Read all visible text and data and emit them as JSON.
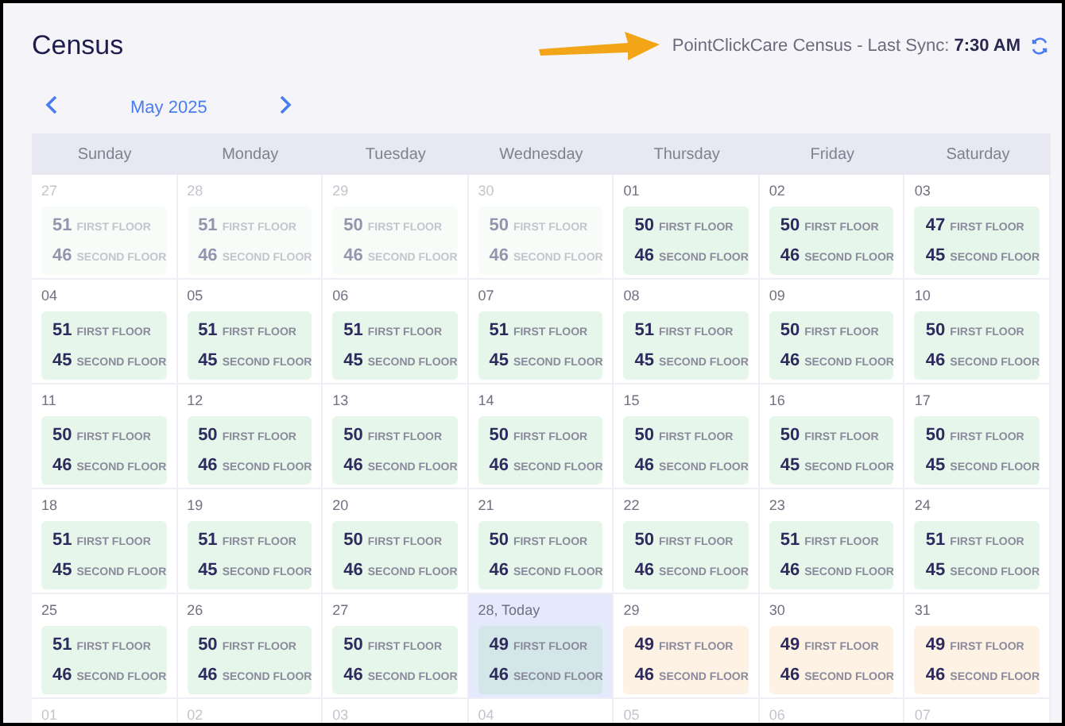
{
  "title": "Census",
  "sync": {
    "label": "PointClickCare Census - Last Sync:",
    "time": "7:30 AM"
  },
  "month": "May 2025",
  "weekdays": [
    "Sunday",
    "Monday",
    "Tuesday",
    "Wednesday",
    "Thursday",
    "Friday",
    "Saturday"
  ],
  "weeks": [
    [
      {
        "date": "27",
        "kind": "outside",
        "floors": [
          {
            "count": "51",
            "label": "FIRST FLOOR"
          },
          {
            "count": "46",
            "label": "SECOND FLOOR"
          }
        ]
      },
      {
        "date": "28",
        "kind": "outside",
        "floors": [
          {
            "count": "51",
            "label": "FIRST FLOOR"
          },
          {
            "count": "46",
            "label": "SECOND FLOOR"
          }
        ]
      },
      {
        "date": "29",
        "kind": "outside",
        "floors": [
          {
            "count": "50",
            "label": "FIRST FLOOR"
          },
          {
            "count": "46",
            "label": "SECOND FLOOR"
          }
        ]
      },
      {
        "date": "30",
        "kind": "outside",
        "floors": [
          {
            "count": "50",
            "label": "FIRST FLOOR"
          },
          {
            "count": "46",
            "label": "SECOND FLOOR"
          }
        ]
      },
      {
        "date": "01",
        "kind": "actual",
        "floors": [
          {
            "count": "50",
            "label": "FIRST FLOOR"
          },
          {
            "count": "46",
            "label": "SECOND FLOOR"
          }
        ]
      },
      {
        "date": "02",
        "kind": "actual",
        "floors": [
          {
            "count": "50",
            "label": "FIRST FLOOR"
          },
          {
            "count": "46",
            "label": "SECOND FLOOR"
          }
        ]
      },
      {
        "date": "03",
        "kind": "actual",
        "floors": [
          {
            "count": "47",
            "label": "FIRST FLOOR"
          },
          {
            "count": "45",
            "label": "SECOND FLOOR"
          }
        ]
      }
    ],
    [
      {
        "date": "04",
        "kind": "actual",
        "floors": [
          {
            "count": "51",
            "label": "FIRST FLOOR"
          },
          {
            "count": "45",
            "label": "SECOND FLOOR"
          }
        ]
      },
      {
        "date": "05",
        "kind": "actual",
        "floors": [
          {
            "count": "51",
            "label": "FIRST FLOOR"
          },
          {
            "count": "45",
            "label": "SECOND FLOOR"
          }
        ]
      },
      {
        "date": "06",
        "kind": "actual",
        "floors": [
          {
            "count": "51",
            "label": "FIRST FLOOR"
          },
          {
            "count": "45",
            "label": "SECOND FLOOR"
          }
        ]
      },
      {
        "date": "07",
        "kind": "actual",
        "floors": [
          {
            "count": "51",
            "label": "FIRST FLOOR"
          },
          {
            "count": "45",
            "label": "SECOND FLOOR"
          }
        ]
      },
      {
        "date": "08",
        "kind": "actual",
        "floors": [
          {
            "count": "51",
            "label": "FIRST FLOOR"
          },
          {
            "count": "45",
            "label": "SECOND FLOOR"
          }
        ]
      },
      {
        "date": "09",
        "kind": "actual",
        "floors": [
          {
            "count": "50",
            "label": "FIRST FLOOR"
          },
          {
            "count": "46",
            "label": "SECOND FLOOR"
          }
        ]
      },
      {
        "date": "10",
        "kind": "actual",
        "floors": [
          {
            "count": "50",
            "label": "FIRST FLOOR"
          },
          {
            "count": "46",
            "label": "SECOND FLOOR"
          }
        ]
      }
    ],
    [
      {
        "date": "11",
        "kind": "actual",
        "floors": [
          {
            "count": "50",
            "label": "FIRST FLOOR"
          },
          {
            "count": "46",
            "label": "SECOND FLOOR"
          }
        ]
      },
      {
        "date": "12",
        "kind": "actual",
        "floors": [
          {
            "count": "50",
            "label": "FIRST FLOOR"
          },
          {
            "count": "46",
            "label": "SECOND FLOOR"
          }
        ]
      },
      {
        "date": "13",
        "kind": "actual",
        "floors": [
          {
            "count": "50",
            "label": "FIRST FLOOR"
          },
          {
            "count": "46",
            "label": "SECOND FLOOR"
          }
        ]
      },
      {
        "date": "14",
        "kind": "actual",
        "floors": [
          {
            "count": "50",
            "label": "FIRST FLOOR"
          },
          {
            "count": "46",
            "label": "SECOND FLOOR"
          }
        ]
      },
      {
        "date": "15",
        "kind": "actual",
        "floors": [
          {
            "count": "50",
            "label": "FIRST FLOOR"
          },
          {
            "count": "46",
            "label": "SECOND FLOOR"
          }
        ]
      },
      {
        "date": "16",
        "kind": "actual",
        "floors": [
          {
            "count": "50",
            "label": "FIRST FLOOR"
          },
          {
            "count": "45",
            "label": "SECOND FLOOR"
          }
        ]
      },
      {
        "date": "17",
        "kind": "actual",
        "floors": [
          {
            "count": "50",
            "label": "FIRST FLOOR"
          },
          {
            "count": "45",
            "label": "SECOND FLOOR"
          }
        ]
      }
    ],
    [
      {
        "date": "18",
        "kind": "actual",
        "floors": [
          {
            "count": "51",
            "label": "FIRST FLOOR"
          },
          {
            "count": "45",
            "label": "SECOND FLOOR"
          }
        ]
      },
      {
        "date": "19",
        "kind": "actual",
        "floors": [
          {
            "count": "51",
            "label": "FIRST FLOOR"
          },
          {
            "count": "45",
            "label": "SECOND FLOOR"
          }
        ]
      },
      {
        "date": "20",
        "kind": "actual",
        "floors": [
          {
            "count": "50",
            "label": "FIRST FLOOR"
          },
          {
            "count": "46",
            "label": "SECOND FLOOR"
          }
        ]
      },
      {
        "date": "21",
        "kind": "actual",
        "floors": [
          {
            "count": "50",
            "label": "FIRST FLOOR"
          },
          {
            "count": "46",
            "label": "SECOND FLOOR"
          }
        ]
      },
      {
        "date": "22",
        "kind": "actual",
        "floors": [
          {
            "count": "50",
            "label": "FIRST FLOOR"
          },
          {
            "count": "46",
            "label": "SECOND FLOOR"
          }
        ]
      },
      {
        "date": "23",
        "kind": "actual",
        "floors": [
          {
            "count": "51",
            "label": "FIRST FLOOR"
          },
          {
            "count": "46",
            "label": "SECOND FLOOR"
          }
        ]
      },
      {
        "date": "24",
        "kind": "actual",
        "floors": [
          {
            "count": "51",
            "label": "FIRST FLOOR"
          },
          {
            "count": "45",
            "label": "SECOND FLOOR"
          }
        ]
      }
    ],
    [
      {
        "date": "25",
        "kind": "actual",
        "floors": [
          {
            "count": "51",
            "label": "FIRST FLOOR"
          },
          {
            "count": "46",
            "label": "SECOND FLOOR"
          }
        ]
      },
      {
        "date": "26",
        "kind": "actual",
        "floors": [
          {
            "count": "50",
            "label": "FIRST FLOOR"
          },
          {
            "count": "46",
            "label": "SECOND FLOOR"
          }
        ]
      },
      {
        "date": "27",
        "kind": "actual",
        "floors": [
          {
            "count": "50",
            "label": "FIRST FLOOR"
          },
          {
            "count": "46",
            "label": "SECOND FLOOR"
          }
        ]
      },
      {
        "date": "28, Today",
        "kind": "today",
        "floors": [
          {
            "count": "49",
            "label": "FIRST FLOOR"
          },
          {
            "count": "46",
            "label": "SECOND FLOOR"
          }
        ]
      },
      {
        "date": "29",
        "kind": "forecast",
        "floors": [
          {
            "count": "49",
            "label": "FIRST FLOOR"
          },
          {
            "count": "46",
            "label": "SECOND FLOOR"
          }
        ]
      },
      {
        "date": "30",
        "kind": "forecast",
        "floors": [
          {
            "count": "49",
            "label": "FIRST FLOOR"
          },
          {
            "count": "46",
            "label": "SECOND FLOOR"
          }
        ]
      },
      {
        "date": "31",
        "kind": "forecast",
        "floors": [
          {
            "count": "49",
            "label": "FIRST FLOOR"
          },
          {
            "count": "46",
            "label": "SECOND FLOOR"
          }
        ]
      }
    ],
    [
      {
        "date": "01",
        "kind": "outside"
      },
      {
        "date": "02",
        "kind": "outside"
      },
      {
        "date": "03",
        "kind": "outside"
      },
      {
        "date": "04",
        "kind": "outside"
      },
      {
        "date": "05",
        "kind": "outside"
      },
      {
        "date": "06",
        "kind": "outside"
      },
      {
        "date": "07",
        "kind": "outside"
      }
    ]
  ]
}
